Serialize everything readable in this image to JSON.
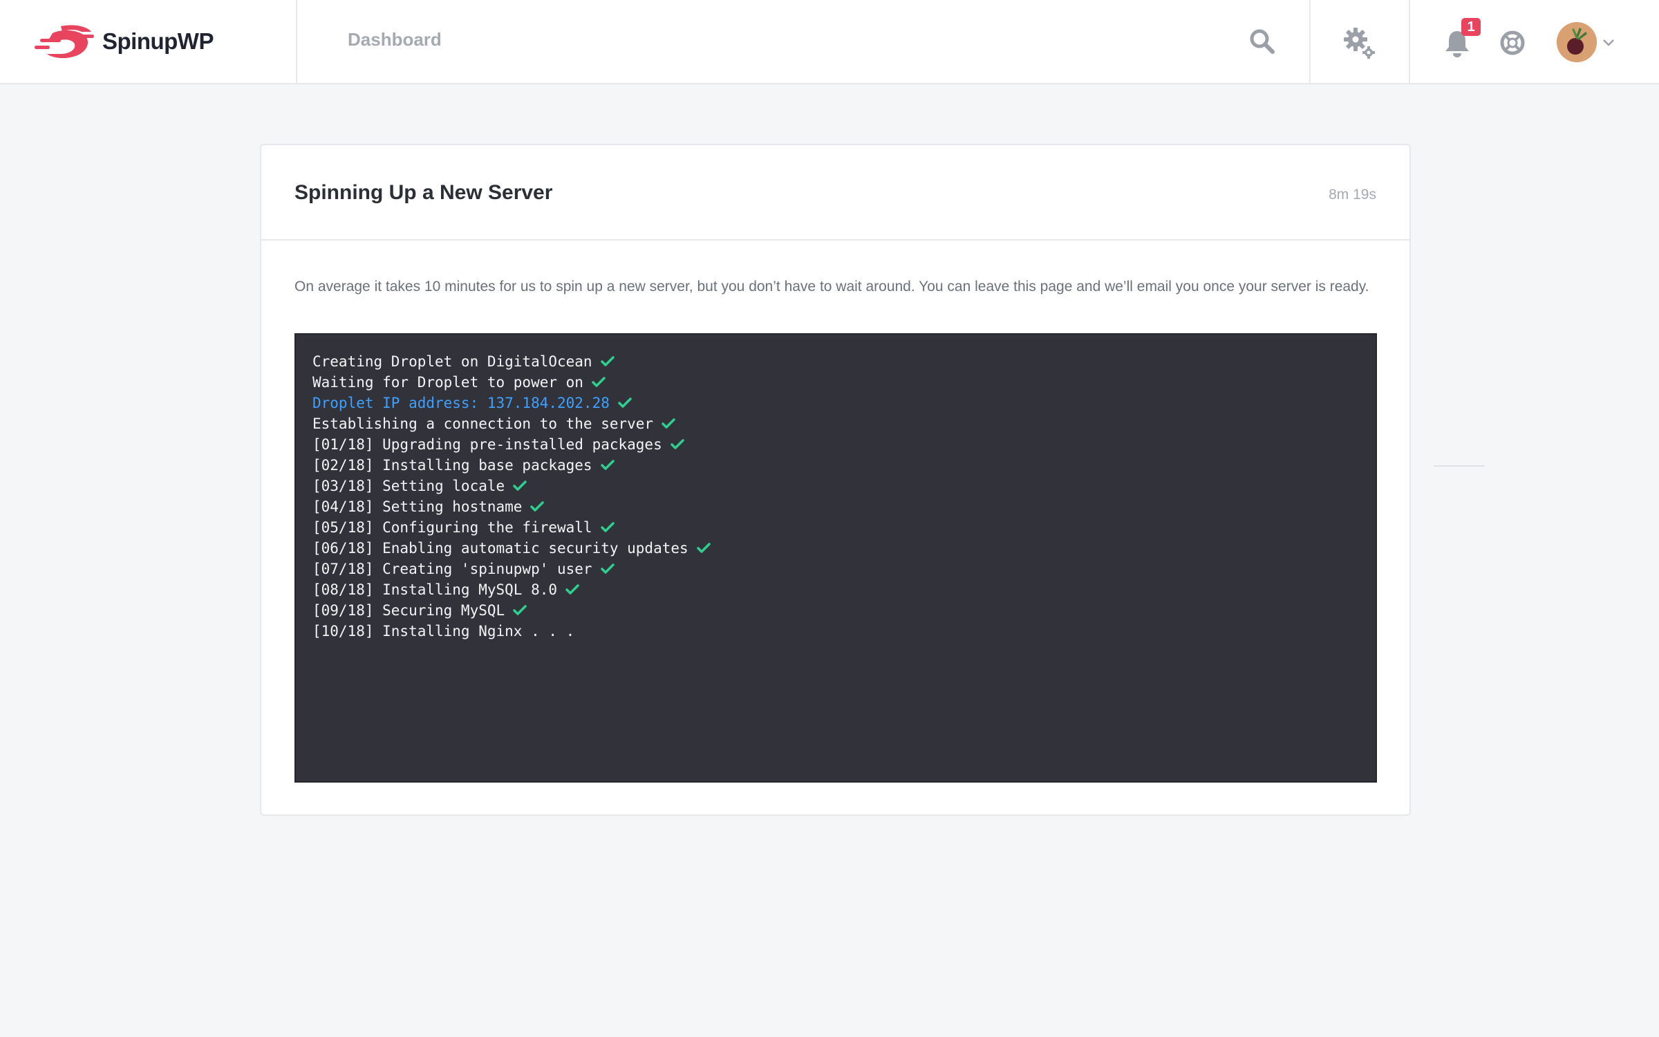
{
  "header": {
    "brand": "SpinupWP",
    "nav_dashboard": "Dashboard",
    "notification_count": "1",
    "brand_color": "#e8445e"
  },
  "card": {
    "title": "Spinning Up a New Server",
    "elapsed": "8m 19s",
    "description": "On average it takes 10 minutes for us to spin up a new server, but you don’t have to wait around. You can leave this page and we’ll email you once your server is ready."
  },
  "terminal": {
    "lines": [
      {
        "text": "Creating Droplet on DigitalOcean",
        "done": true
      },
      {
        "text": "Waiting for Droplet to power on",
        "done": true
      },
      {
        "text": "Droplet IP address: 137.184.202.28",
        "done": true,
        "highlight": true
      },
      {
        "text": "Establishing a connection to the server",
        "done": true
      },
      {
        "text": "[01/18] Upgrading pre-installed packages",
        "done": true
      },
      {
        "text": "[02/18] Installing base packages",
        "done": true
      },
      {
        "text": "[03/18] Setting locale",
        "done": true
      },
      {
        "text": "[04/18] Setting hostname",
        "done": true
      },
      {
        "text": "[05/18] Configuring the firewall",
        "done": true
      },
      {
        "text": "[06/18] Enabling automatic security updates",
        "done": true
      },
      {
        "text": "[07/18] Creating 'spinupwp' user",
        "done": true
      },
      {
        "text": "[08/18] Installing MySQL 8.0",
        "done": true
      },
      {
        "text": "[09/18] Securing MySQL",
        "done": true
      },
      {
        "text": "[10/18] Installing Nginx . . .",
        "done": false
      }
    ],
    "check_color": "#2ecf8f",
    "highlight_color": "#3ea0ff"
  }
}
